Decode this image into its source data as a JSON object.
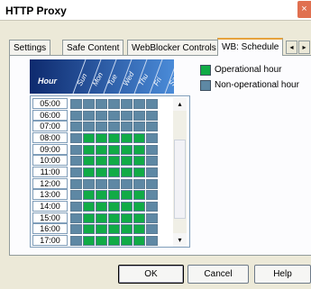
{
  "window": {
    "title": "HTTP Proxy",
    "close_glyph": "×"
  },
  "tabs": [
    {
      "label": "Settings"
    },
    {
      "label": "Safe Content"
    },
    {
      "label": "WebBlocker Controls"
    },
    {
      "label": "WB: Schedule"
    }
  ],
  "tab_scroll": {
    "left": "◂",
    "right": "▸"
  },
  "schedule": {
    "hour_header": "Hour",
    "days": [
      "Sun",
      "Mon",
      "Tue",
      "Wed",
      "Thu",
      "Fri",
      "Sat"
    ],
    "hours": [
      {
        "label": "05:00",
        "cells": [
          0,
          0,
          0,
          0,
          0,
          0,
          0
        ]
      },
      {
        "label": "06:00",
        "cells": [
          0,
          0,
          0,
          0,
          0,
          0,
          0
        ]
      },
      {
        "label": "07:00",
        "cells": [
          0,
          0,
          0,
          0,
          0,
          0,
          0
        ]
      },
      {
        "label": "08:00",
        "cells": [
          0,
          1,
          1,
          1,
          1,
          1,
          0
        ]
      },
      {
        "label": "09:00",
        "cells": [
          0,
          1,
          1,
          1,
          1,
          1,
          0
        ]
      },
      {
        "label": "10:00",
        "cells": [
          0,
          1,
          1,
          1,
          1,
          1,
          0
        ]
      },
      {
        "label": "11:00",
        "cells": [
          0,
          1,
          1,
          1,
          1,
          1,
          0
        ]
      },
      {
        "label": "12:00",
        "cells": [
          0,
          0,
          0,
          0,
          0,
          0,
          0
        ]
      },
      {
        "label": "13:00",
        "cells": [
          0,
          1,
          1,
          1,
          1,
          1,
          0
        ]
      },
      {
        "label": "14:00",
        "cells": [
          0,
          1,
          1,
          1,
          1,
          1,
          0
        ]
      },
      {
        "label": "15:00",
        "cells": [
          0,
          1,
          1,
          1,
          1,
          1,
          0
        ]
      },
      {
        "label": "16:00",
        "cells": [
          0,
          1,
          1,
          1,
          1,
          1,
          0
        ]
      },
      {
        "label": "17:00",
        "cells": [
          0,
          1,
          1,
          1,
          1,
          1,
          0
        ]
      }
    ]
  },
  "legend": {
    "operational": {
      "label": "Operational hour",
      "color": "#11ab46"
    },
    "non_operational": {
      "label": "Non-operational hour",
      "color": "#5e88a4"
    }
  },
  "scrollbar": {
    "up": "▴",
    "down": "▾"
  },
  "buttons": {
    "ok": "OK",
    "cancel": "Cancel",
    "help": "Help"
  }
}
